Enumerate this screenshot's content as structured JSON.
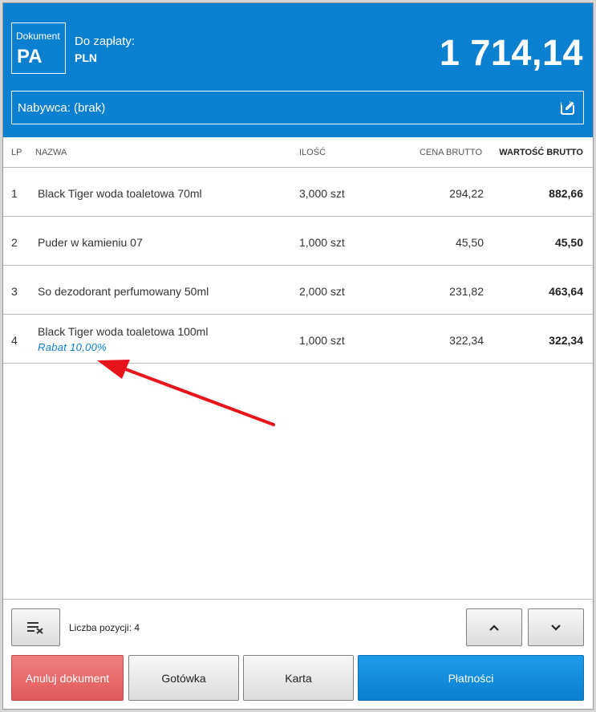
{
  "header": {
    "doc_label": "Dokument",
    "doc_type": "PA",
    "pay_label": "Do zapłaty:",
    "currency": "PLN",
    "total": "1 714,14",
    "buyer": "Nabywca: (brak)"
  },
  "table": {
    "columns": {
      "lp": "LP",
      "name": "NAZWA",
      "qty": "ILOŚĆ",
      "price": "CENA BRUTTO",
      "value": "WARTOŚĆ BRUTTO"
    },
    "rows": [
      {
        "lp": "1",
        "name": "Black Tiger woda toaletowa 70ml",
        "qty": "3,000 szt",
        "price": "294,22",
        "value": "882,66"
      },
      {
        "lp": "2",
        "name": "Puder w kamieniu 07",
        "qty": "1,000 szt",
        "price": "45,50",
        "value": "45,50"
      },
      {
        "lp": "3",
        "name": "So dezodorant perfumowany 50ml",
        "qty": "2,000 szt",
        "price": "231,82",
        "value": "463,64"
      },
      {
        "lp": "4",
        "name": "Black Tiger woda toaletowa 100ml",
        "discount": "Rabat 10,00%",
        "qty": "1,000 szt",
        "price": "322,34",
        "value": "322,34"
      }
    ]
  },
  "footer": {
    "count_label": "Liczba pozycji: 4",
    "cancel": "Anuluj dokument",
    "cash": "Gotówka",
    "card": "Karta",
    "payments": "Płatności"
  },
  "icons": {
    "edit": "edit-icon",
    "clear": "clear-list-icon",
    "up": "chevron-up-icon",
    "down": "chevron-down-icon"
  },
  "colors": {
    "accent": "#0b7fd0",
    "cancel": "#e86a6a",
    "annotation": "#e8141c"
  }
}
